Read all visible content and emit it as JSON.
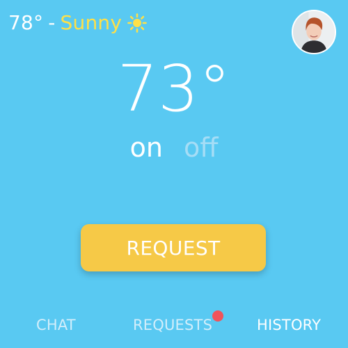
{
  "weather": {
    "temperature": "78°",
    "separator": "-",
    "condition": "Sunny",
    "icon": "sun-icon"
  },
  "thermostat": {
    "setpoint": "73°",
    "on_label": "on",
    "off_label": "off",
    "active_state": "on"
  },
  "actions": {
    "request_label": "REQUEST"
  },
  "tabs": [
    {
      "label": "CHAT",
      "active": false
    },
    {
      "label": "REQUESTS",
      "active": false,
      "has_notification": true
    },
    {
      "label": "HISTORY",
      "active": true
    }
  ],
  "colors": {
    "background": "#59c9f2",
    "accent_yellow": "#f6c947",
    "condition_text": "#ffe047",
    "notification": "#f0545b",
    "active_text": "#ffffff",
    "inactive_text": "#d2eefb"
  }
}
